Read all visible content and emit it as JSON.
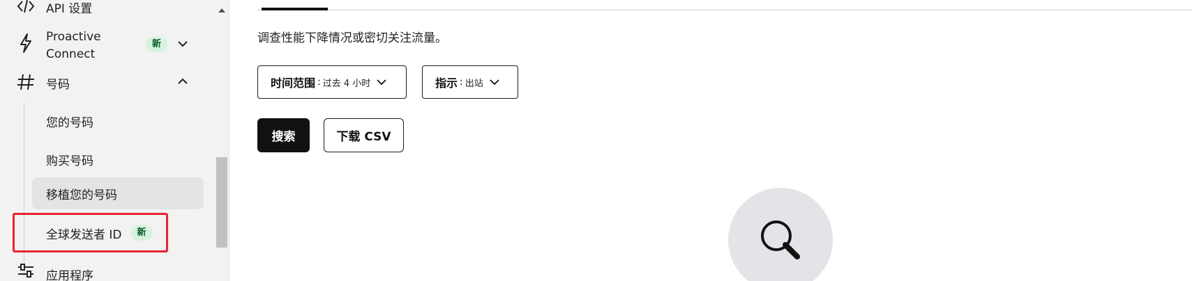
{
  "sidebar": {
    "api_settings": {
      "label": "API 设置",
      "icon": "code-icon"
    },
    "proactive_connect": {
      "label_line1": "Proactive",
      "label_line2": "Connect",
      "badge": "新",
      "icon": "lightning-icon"
    },
    "numbers": {
      "label": "号码",
      "icon": "hash-icon",
      "items": [
        {
          "label": "您的号码"
        },
        {
          "label": "购买号码"
        },
        {
          "label": "移植您的号码",
          "selected": true
        },
        {
          "label": "全球发送者 ID",
          "badge": "新"
        }
      ]
    },
    "applications": {
      "label": "应用程序",
      "icon": "sliders-icon"
    }
  },
  "main": {
    "description": "调查性能下降情况或密切关注流量。",
    "filters": [
      {
        "name": "时间范围",
        "separator": ":",
        "value": "过去 4 小时"
      },
      {
        "name": "指示",
        "separator": ":",
        "value": "出站"
      }
    ],
    "buttons": {
      "search": "搜索",
      "download": "下载 CSV"
    }
  },
  "colors": {
    "sidebar_bg": "#f2f2f2",
    "badge_bg": "#d6f2df",
    "badge_text": "#0b5b2a",
    "highlight": "#e8232e",
    "primary_button": "#111111"
  }
}
